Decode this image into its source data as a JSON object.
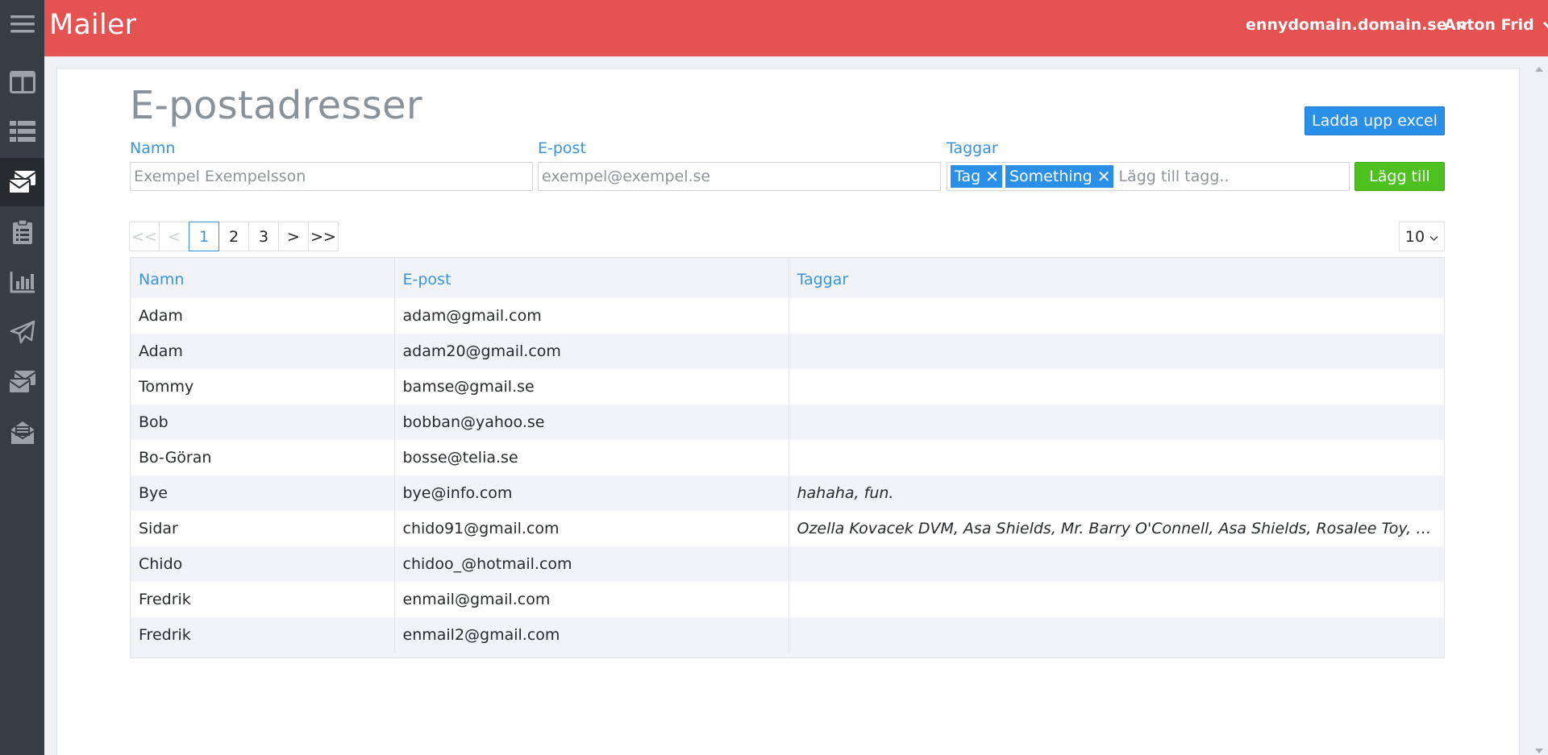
{
  "app": {
    "title": "Mailer"
  },
  "header": {
    "domain": "ennydomain.domain.se",
    "user": "Anton Frid"
  },
  "sidebar": {
    "items": [
      {
        "icon": "menu-icon"
      },
      {
        "icon": "dashboard-icon"
      },
      {
        "icon": "list-icon"
      },
      {
        "icon": "mailing-list-icon",
        "active": true
      },
      {
        "icon": "clipboard-icon"
      },
      {
        "icon": "bar-chart-icon"
      },
      {
        "icon": "paper-plane-icon"
      },
      {
        "icon": "mail-stack-icon"
      },
      {
        "icon": "envelope-open-icon"
      }
    ]
  },
  "page": {
    "title": "E-postadresser",
    "upload_button": "Ladda upp excel",
    "add_button": "Lägg till"
  },
  "form": {
    "name_label": "Namn",
    "name_placeholder": "Exempel Exempelsson",
    "email_label": "E-post",
    "email_placeholder": "exempel@exempel.se",
    "tags_label": "Taggar",
    "tags": [
      "Tag",
      "Something"
    ],
    "tag_placeholder": "Lägg till tagg.."
  },
  "pagination": {
    "first": "<<",
    "prev": "<",
    "pages": [
      "1",
      "2",
      "3"
    ],
    "current": "1",
    "next": ">",
    "last": ">>",
    "per_page": "10"
  },
  "table": {
    "columns": [
      "Namn",
      "E-post",
      "Taggar"
    ],
    "rows": [
      [
        "Adam",
        "adam@gmail.com",
        ""
      ],
      [
        "Adam",
        "adam20@gmail.com",
        ""
      ],
      [
        "Tommy",
        "bamse@gmail.se",
        ""
      ],
      [
        "Bob",
        "bobban@yahoo.se",
        ""
      ],
      [
        "Bo-Göran",
        "bosse@telia.se",
        ""
      ],
      [
        "Bye",
        "bye@info.com",
        "hahaha, fun."
      ],
      [
        "Sidar",
        "chido91@gmail.com",
        "Ozella Kovacek DVM, Asa Shields, Mr. Barry O'Connell, Asa Shields, Rosalee Toy, Wain..."
      ],
      [
        "Chido",
        "chidoo_@hotmail.com",
        ""
      ],
      [
        "Fredrik",
        "enmail@gmail.com",
        ""
      ],
      [
        "Fredrik",
        "enmail2@gmail.com",
        ""
      ]
    ]
  },
  "colors": {
    "header": "#e55252",
    "sidebar": "#363d44",
    "accent_blue": "#2a8fe6",
    "add_green": "#4ec01f"
  }
}
